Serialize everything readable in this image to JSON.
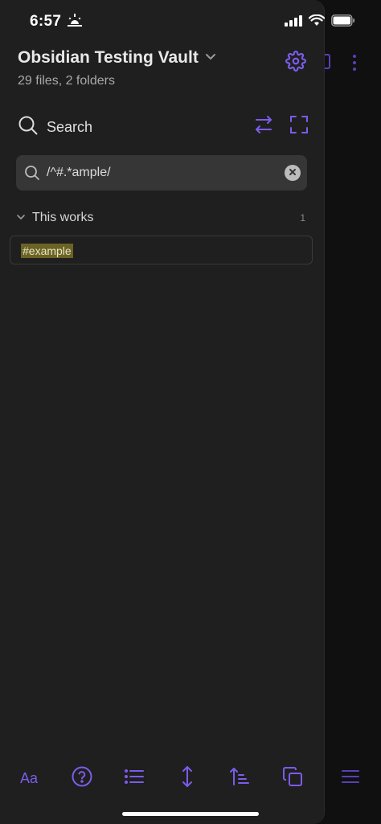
{
  "status_bar": {
    "time": "6:57"
  },
  "vault": {
    "name": "Obsidian Testing Vault",
    "stats": "29 files, 2 folders"
  },
  "search_panel": {
    "label": "Search",
    "query": "/^#.*ample/"
  },
  "results": {
    "groups": [
      {
        "title": "This works",
        "count": "1",
        "matches": [
          {
            "text": "#example"
          }
        ]
      }
    ]
  },
  "bottom_toolbar": {
    "font_label": "Aa"
  },
  "colors": {
    "accent": "#7c5cea",
    "drawer_bg": "#1f1f1f",
    "match_highlight": "#6b6326"
  }
}
